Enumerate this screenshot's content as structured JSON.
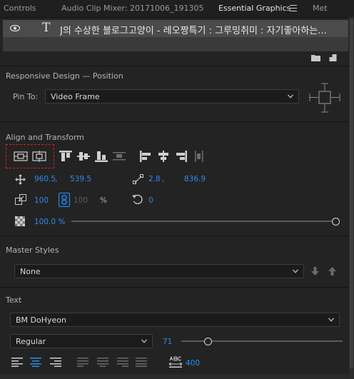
{
  "tabs": [
    {
      "label": "Controls"
    },
    {
      "label": "Audio Clip Mixer: 20171006_191305"
    },
    {
      "label": "Essential Graphics"
    },
    {
      "label": "Met"
    }
  ],
  "layer": {
    "name": "J의 수상한 블로그고양이 - 레오짱특기 : 그루밍취미 : 자기좋아하는..."
  },
  "responsive": {
    "title": "Responsive Design — Position",
    "pin_label": "Pin To:",
    "pin_value": "Video Frame"
  },
  "align": {
    "title": "Align and Transform",
    "pos_x": "960.5",
    "comma1": ",",
    "pos_y": "539.5",
    "anchor_x": "2.8",
    "comma2": ",",
    "anchor_y": "836.9",
    "scale": "100",
    "scale2": "100",
    "percent": "%",
    "rotation": "0",
    "opacity": "100.0 %"
  },
  "master": {
    "title": "Master Styles",
    "value": "None"
  },
  "text": {
    "title": "Text",
    "font": "BM DoHyeon",
    "style": "Regular",
    "size": "71",
    "tracking": "400"
  },
  "colors": {
    "accent": "#2d8ceb",
    "highlight_box": "#e02020"
  }
}
